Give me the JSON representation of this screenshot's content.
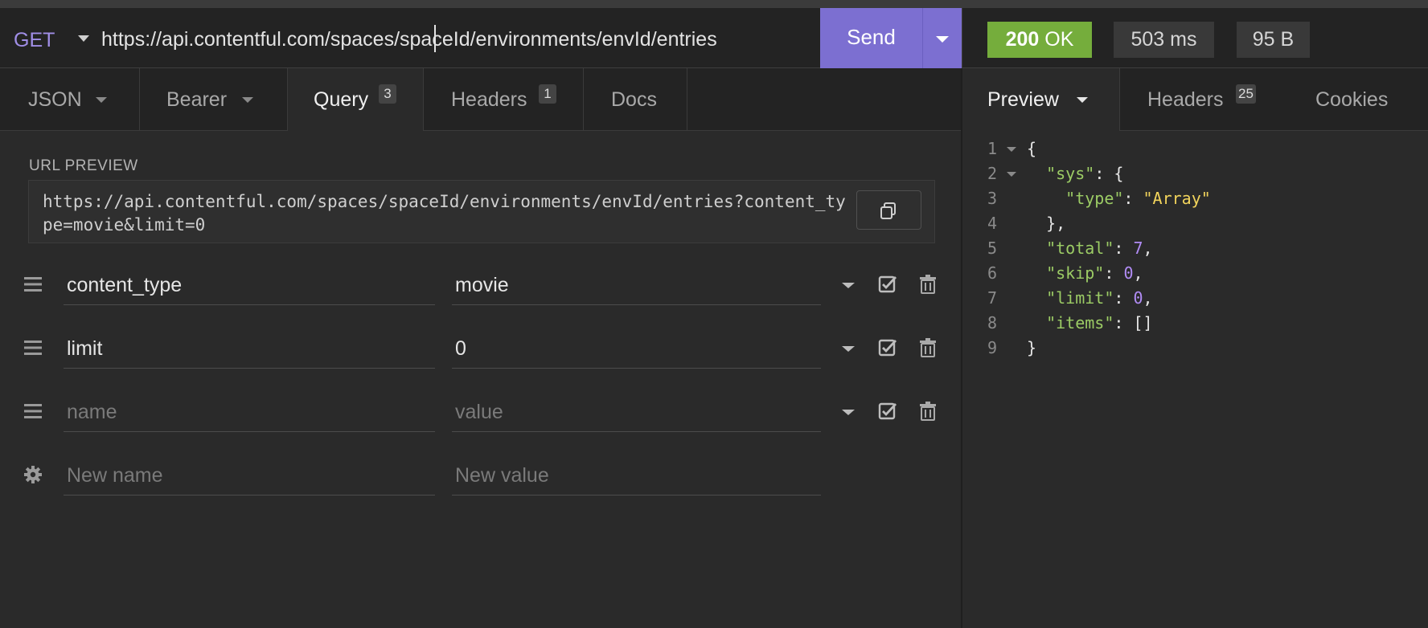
{
  "request": {
    "method": "GET",
    "url": "https://api.contentful.com/spaces/spaceId/environments/envId/entries",
    "send_label": "Send"
  },
  "response": {
    "status_code": "200",
    "status_text": "OK",
    "time": "503 ms",
    "size": "95 B",
    "status_color": "#75ad3c"
  },
  "request_tabs": [
    {
      "label": "JSON",
      "has_dropdown": true
    },
    {
      "label": "Bearer",
      "has_dropdown": true
    },
    {
      "label": "Query",
      "badge": "3",
      "active": true
    },
    {
      "label": "Headers",
      "badge": "1"
    },
    {
      "label": "Docs"
    }
  ],
  "url_preview": {
    "label": "URL PREVIEW",
    "value": "https://api.contentful.com/spaces/spaceId/environments/envId/entries?content_type=movie&limit=0"
  },
  "query_params": [
    {
      "name": "content_type",
      "value": "movie"
    },
    {
      "name": "limit",
      "value": "0"
    }
  ],
  "empty_param": {
    "name_placeholder": "name",
    "value_placeholder": "value"
  },
  "new_param": {
    "name_placeholder": "New name",
    "value_placeholder": "New value"
  },
  "response_tabs": [
    {
      "label": "Preview",
      "active": true,
      "has_dropdown": true
    },
    {
      "label": "Headers",
      "badge": "25"
    },
    {
      "label": "Cookies"
    }
  ],
  "response_body": {
    "line_numbers": [
      "1",
      "2",
      "3",
      "4",
      "5",
      "6",
      "7",
      "8",
      "9"
    ],
    "lines": [
      [
        {
          "t": "p",
          "v": "{"
        }
      ],
      [
        {
          "t": "p",
          "v": "  "
        },
        {
          "t": "k",
          "v": "\"sys\""
        },
        {
          "t": "p",
          "v": ": {"
        }
      ],
      [
        {
          "t": "p",
          "v": "    "
        },
        {
          "t": "k",
          "v": "\"type\""
        },
        {
          "t": "p",
          "v": ": "
        },
        {
          "t": "s",
          "v": "\"Array\""
        }
      ],
      [
        {
          "t": "p",
          "v": "  },"
        }
      ],
      [
        {
          "t": "p",
          "v": "  "
        },
        {
          "t": "k",
          "v": "\"total\""
        },
        {
          "t": "p",
          "v": ": "
        },
        {
          "t": "n",
          "v": "7"
        },
        {
          "t": "p",
          "v": ","
        }
      ],
      [
        {
          "t": "p",
          "v": "  "
        },
        {
          "t": "k",
          "v": "\"skip\""
        },
        {
          "t": "p",
          "v": ": "
        },
        {
          "t": "n",
          "v": "0"
        },
        {
          "t": "p",
          "v": ","
        }
      ],
      [
        {
          "t": "p",
          "v": "  "
        },
        {
          "t": "k",
          "v": "\"limit\""
        },
        {
          "t": "p",
          "v": ": "
        },
        {
          "t": "n",
          "v": "0"
        },
        {
          "t": "p",
          "v": ","
        }
      ],
      [
        {
          "t": "p",
          "v": "  "
        },
        {
          "t": "k",
          "v": "\"items\""
        },
        {
          "t": "p",
          "v": ": []"
        }
      ],
      [
        {
          "t": "p",
          "v": "}"
        }
      ]
    ]
  },
  "icons": {
    "method_dropdown": "chevron-down-icon",
    "send_dropdown": "chevron-down-icon",
    "copy": "copy-icon",
    "drag": "drag-handle-icon",
    "enabled": "checkbox-checked-icon",
    "delete": "trash-icon",
    "settings": "gear-icon"
  },
  "colors": {
    "accent": "#7c6fd1",
    "json_key": "#9ccc65",
    "json_string": "#f2d45c",
    "json_number": "#b18cf5"
  }
}
